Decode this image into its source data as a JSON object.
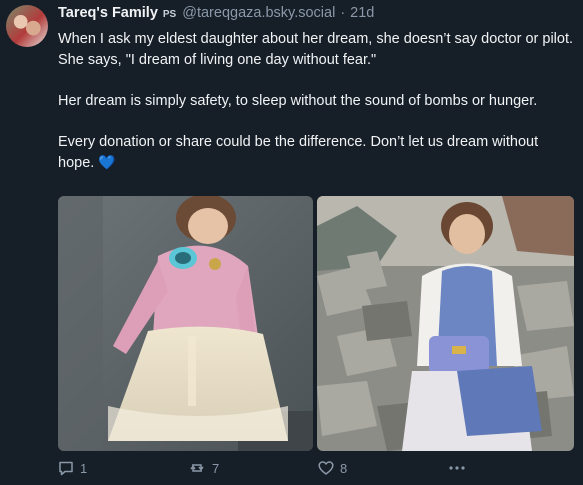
{
  "author": {
    "display_name": "Tareq's Family",
    "badge": "PS",
    "handle": "@tareqgaza.bsky.social",
    "separator": "·",
    "time": "21d"
  },
  "post": {
    "paragraphs": [
      "When I ask my eldest daughter about her dream, she doesn’t say doctor or pilot. She says, \"I dream of living one day without fear.\"",
      "Her dream is simply safety, to sleep without the sound of bombs or hunger.",
      "Every donation or share could be the difference. Don’t let us dream without hope."
    ],
    "heart_emoji": "💙"
  },
  "media": [
    {
      "icon": "photo-girl-pink-sweater"
    },
    {
      "icon": "photo-girl-on-rubble"
    }
  ],
  "actions": {
    "reply_count": "1",
    "repost_count": "7",
    "like_count": "8"
  },
  "colors": {
    "background": "#161e27",
    "text": "#f1f3f5",
    "muted": "#8a98a8",
    "heart": "#1d8bf1"
  }
}
